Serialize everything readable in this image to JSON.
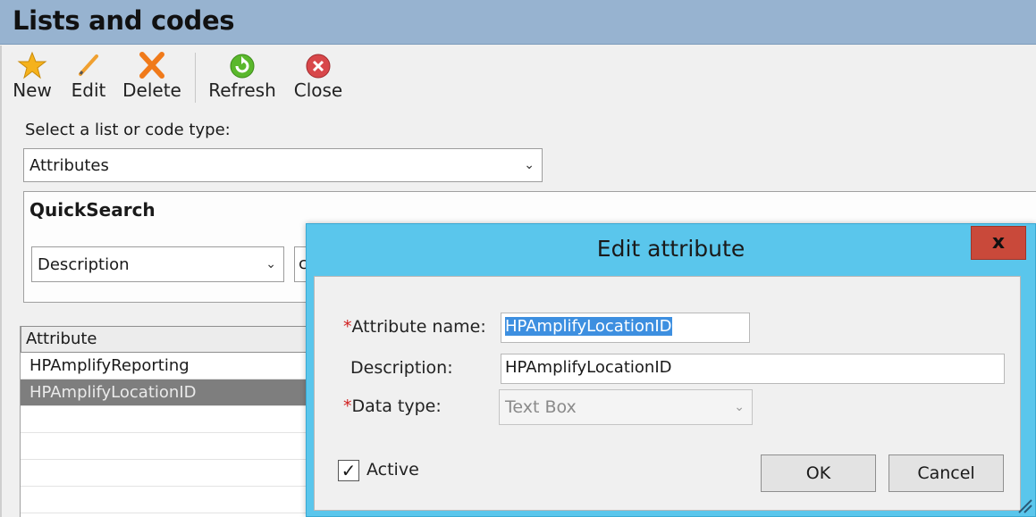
{
  "window": {
    "title": "Lists and codes"
  },
  "toolbar": {
    "new_label": "New",
    "edit_label": "Edit",
    "delete_label": "Delete",
    "refresh_label": "Refresh",
    "close_label": "Close"
  },
  "list_select": {
    "label": "Select a list or code type:",
    "value": "Attributes"
  },
  "quicksearch": {
    "title": "QuickSearch",
    "field_value": "Description",
    "input_value": "c"
  },
  "grid": {
    "header": "Attribute",
    "rows": [
      "HPAmplifyReporting",
      "HPAmplifyLocationID"
    ]
  },
  "dialog": {
    "title": "Edit attribute",
    "close_glyph": "x",
    "required_mark": "*",
    "attribute_name_label": "Attribute name:",
    "attribute_name_value": "HPAmplifyLocationID",
    "description_label": "Description:",
    "description_value": "HPAmplifyLocationID",
    "data_type_label": "Data type:",
    "data_type_value": "Text Box",
    "active_label": "Active",
    "active_checked": true,
    "ok_label": "OK",
    "cancel_label": "Cancel"
  },
  "colors": {
    "titlebar": "#97b3d0",
    "dialog_frame": "#5ac6ec",
    "close_button": "#c9493a",
    "selected_row": "#7e7e7e",
    "selection_highlight": "#3d8fe0"
  },
  "icons": [
    "star-icon",
    "pencil-icon",
    "x-icon",
    "refresh-icon",
    "close-circle-icon",
    "chevron-down-icon",
    "checkmark-icon",
    "resize-grip-icon"
  ]
}
